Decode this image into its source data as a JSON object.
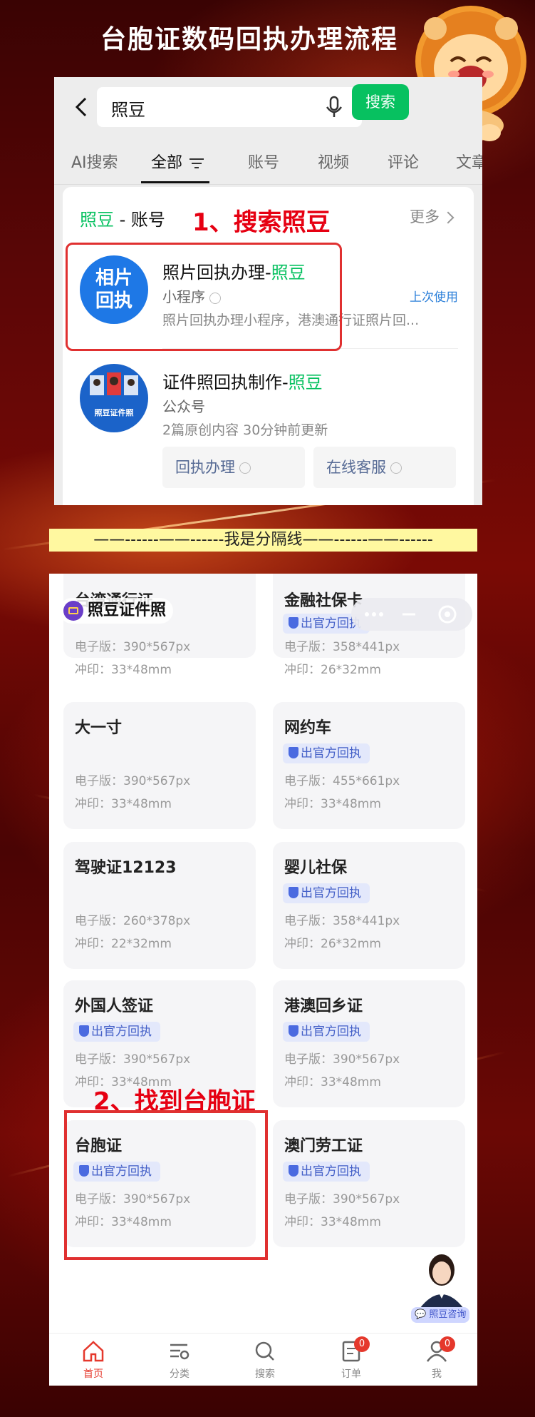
{
  "page_title": "台胞证数码回执办理流程",
  "search": {
    "query": "照豆",
    "button": "搜索"
  },
  "tabs": [
    "AI搜索",
    "全部",
    "账号",
    "视频",
    "评论",
    "文章"
  ],
  "account_section": {
    "head_keyword": "照豆",
    "head_rest": " - 账号",
    "more": "更多",
    "annotation": "1、搜索照豆"
  },
  "results": [
    {
      "logo_text": "相片回执",
      "title_prefix": "照片回执办理-",
      "title_keyword": "照豆",
      "type": "小程序",
      "recent": "上次使用",
      "desc": "照片回执办理小程序，港澳通行证照片回..."
    },
    {
      "logo_text": "照豆证件照",
      "title_prefix": "证件照回执制作-",
      "title_keyword": "照豆",
      "type": "公众号",
      "desc": "2篇原创内容  30分钟前更新",
      "buttons": [
        "回执办理",
        "在线客服"
      ]
    }
  ],
  "separator": "——------——------我是分隔线——------——------",
  "brand_name": "照豆证件照",
  "annotation2": "2、找到台胞证",
  "grid": [
    {
      "title": "台湾通行证",
      "badge": "",
      "e": "电子版：390*567px",
      "p": "冲印：33*48mm"
    },
    {
      "title": "金融社保卡",
      "badge": "出官方回执",
      "e": "电子版：358*441px",
      "p": "冲印：26*32mm"
    },
    {
      "title": "大一寸",
      "badge": "",
      "e": "电子版：390*567px",
      "p": "冲印：33*48mm"
    },
    {
      "title": "网约车",
      "badge": "出官方回执",
      "e": "电子版：455*661px",
      "p": "冲印：33*48mm"
    },
    {
      "title": "驾驶证12123",
      "badge": "",
      "e": "电子版：260*378px",
      "p": "冲印：22*32mm"
    },
    {
      "title": "婴儿社保",
      "badge": "出官方回执",
      "e": "电子版：358*441px",
      "p": "冲印：26*32mm"
    },
    {
      "title": "外国人签证",
      "badge": "出官方回执",
      "e": "电子版：390*567px",
      "p": "冲印：33*48mm"
    },
    {
      "title": "港澳回乡证",
      "badge": "出官方回执",
      "e": "电子版：390*567px",
      "p": "冲印：33*48mm"
    },
    {
      "title": "台胞证",
      "badge": "出官方回执",
      "e": "电子版：390*567px",
      "p": "冲印：33*48mm"
    },
    {
      "title": "澳门劳工证",
      "badge": "出官方回执",
      "e": "电子版：390*567px",
      "p": "冲印：33*48mm"
    }
  ],
  "consult_label": "照豆咨询",
  "tabbar": [
    {
      "label": "首页",
      "icon": "home-icon",
      "badge": ""
    },
    {
      "label": "分类",
      "icon": "category-icon",
      "badge": ""
    },
    {
      "label": "搜索",
      "icon": "search-icon",
      "badge": ""
    },
    {
      "label": "订单",
      "icon": "order-icon",
      "badge": "0"
    },
    {
      "label": "我",
      "icon": "user-icon",
      "badge": "0"
    }
  ],
  "colors": {
    "wechat_green": "#07c160",
    "annotation_red": "#e60012",
    "badge_blue": "#4561c8"
  }
}
